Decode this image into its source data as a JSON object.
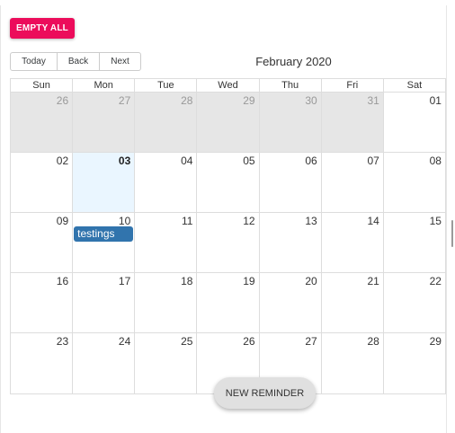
{
  "actions": {
    "empty_all": "EMPTY ALL",
    "new_reminder": "NEW REMINDER"
  },
  "toolbar": {
    "today": "Today",
    "back": "Back",
    "next": "Next"
  },
  "calendar": {
    "month_label": "February 2020",
    "weekdays": [
      "Sun",
      "Mon",
      "Tue",
      "Wed",
      "Thu",
      "Fri",
      "Sat"
    ],
    "weeks": [
      [
        "26",
        "27",
        "28",
        "29",
        "30",
        "31",
        "01"
      ],
      [
        "02",
        "03",
        "04",
        "05",
        "06",
        "07",
        "08"
      ],
      [
        "09",
        "10",
        "11",
        "12",
        "13",
        "14",
        "15"
      ],
      [
        "16",
        "17",
        "18",
        "19",
        "20",
        "21",
        "22"
      ],
      [
        "23",
        "24",
        "25",
        "26",
        "27",
        "28",
        "29"
      ]
    ],
    "today": "03",
    "events": [
      {
        "week": 2,
        "day": 1,
        "title": "testings"
      }
    ],
    "event_color": "#3174ad",
    "accent_color": "#ec0c5b"
  }
}
